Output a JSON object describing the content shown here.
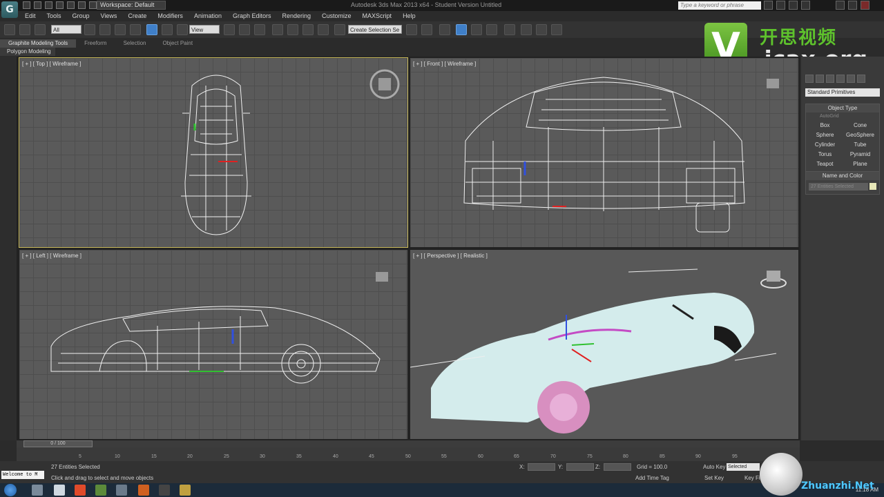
{
  "app": {
    "logo_glyph": "G",
    "workspace": "Workspace: Default",
    "window_title": "Autodesk 3ds Max 2013 x64  -  Student Version  Untitled",
    "search_placeholder": "Type a keyword or phrase"
  },
  "menu": [
    "Edit",
    "Tools",
    "Group",
    "Views",
    "Create",
    "Modifiers",
    "Animation",
    "Graph Editors",
    "Rendering",
    "Customize",
    "MAXScript",
    "Help"
  ],
  "toolbar": {
    "selection_filter": "All",
    "reference_coord": "View",
    "named_selection": "Create Selection Se"
  },
  "ribbon": {
    "tabs": [
      "Graphite Modeling Tools",
      "Freeform",
      "Selection",
      "Object Paint"
    ],
    "subpanel": "Polygon Modeling"
  },
  "watermark": {
    "logo_glyph": "V",
    "chinese": "开思视频",
    "url": ".icax.org",
    "site": "Zhuanzhi.Net"
  },
  "viewports": {
    "top": "[ + ] [ Top ] [ Wireframe ]",
    "front": "[ + ] [ Front ] [ Wireframe ]",
    "left": "[ + ] [ Left ] [ Wireframe ]",
    "perspective": "[ + ] [ Perspective ] [ Realistic ]"
  },
  "command_panel": {
    "category": "Standard Primitives",
    "object_type_title": "Object Type",
    "autogrid": "AutoGrid",
    "primitives": [
      "Box",
      "Cone",
      "Sphere",
      "GeoSphere",
      "Cylinder",
      "Tube",
      "Torus",
      "Pyramid",
      "Teapot",
      "Plane"
    ],
    "name_color_title": "Name and Color",
    "name_field": "27 Entities Selected",
    "swatch_color": "#e8e8b8"
  },
  "timeline": {
    "slider": "0 / 100",
    "ticks": [
      "5",
      "10",
      "15",
      "20",
      "25",
      "30",
      "35",
      "40",
      "45",
      "50",
      "55",
      "60",
      "65",
      "70",
      "75",
      "80",
      "85",
      "90",
      "95"
    ]
  },
  "status": {
    "maxscript": "Welcome to M",
    "selection": "27 Entities Selected",
    "prompt": "Click and drag to select and move objects",
    "x_label": "X:",
    "y_label": "Y:",
    "z_label": "Z:",
    "grid": "Grid = 100.0",
    "add_time_tag": "Add Time Tag",
    "auto_key": "Auto Key",
    "set_key": "Set Key",
    "key_filter": "Selected",
    "key_filters_btn": "Key Fi"
  },
  "taskbar": {
    "clock": "11:18 AM"
  }
}
